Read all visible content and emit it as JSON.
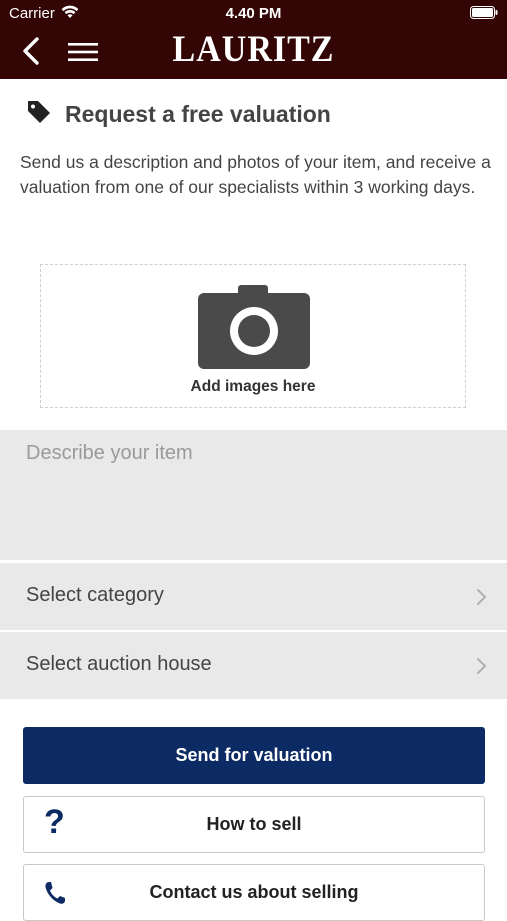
{
  "status_bar": {
    "carrier": "Carrier",
    "time": "4.40 PM"
  },
  "nav": {
    "logo": "LAURITZ",
    "back_icon": "chevron-left-icon",
    "menu_icon": "hamburger-menu-icon"
  },
  "header": {
    "icon": "tag-icon",
    "title": "Request a free valuation",
    "description": "Send us a description and photos of your item, and receive a valuation from one of our specialists within 3 working days."
  },
  "dropzone": {
    "icon": "camera-icon",
    "label": "Add images here"
  },
  "form": {
    "describe_placeholder": "Describe your item",
    "category_label": "Select category",
    "auction_house_label": "Select auction house"
  },
  "actions": {
    "send_label": "Send for valuation",
    "how_to_sell_label": "How to sell",
    "contact_label": "Contact us about selling"
  },
  "colors": {
    "topbar": "#330505",
    "primary_button": "#0c2a63",
    "field_background": "#e9e9e9"
  }
}
